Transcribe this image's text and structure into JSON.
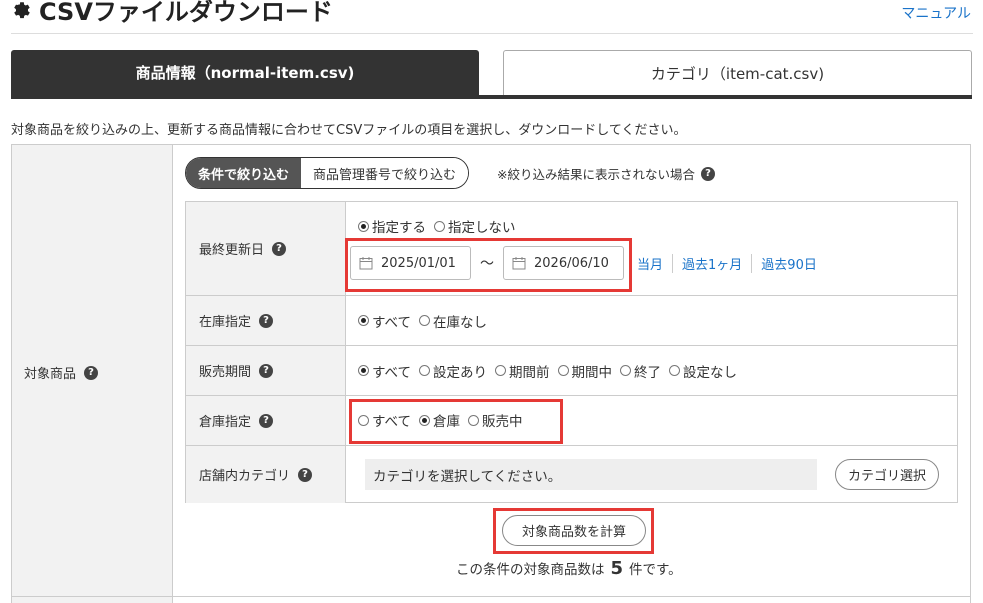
{
  "header": {
    "title": "CSVファイルダウンロード",
    "manual_link": "マニュアル"
  },
  "tabs": [
    {
      "label": "商品情報（normal-item.csv)",
      "active": true
    },
    {
      "label": "カテゴリ（item-cat.csv)",
      "active": false
    }
  ],
  "description": "対象商品を絞り込みの上、更新する商品情報に合わせてCSVファイルの項目を選択し、ダウンロードしてください。",
  "target_label": "対象商品",
  "filter_mode": {
    "options": [
      "条件で絞り込む",
      "商品管理番号で絞り込む"
    ],
    "selected": "条件で絞り込む",
    "note": "※絞り込み結果に表示されない場合"
  },
  "last_updated": {
    "label": "最終更新日",
    "radio": [
      {
        "label": "指定する",
        "checked": true
      },
      {
        "label": "指定しない",
        "checked": false
      }
    ],
    "date_from": "2025/01/01",
    "separator": "～",
    "date_to": "2026/06/10",
    "quick_links": [
      "当月",
      "過去1ヶ月",
      "過去90日"
    ]
  },
  "stock": {
    "label": "在庫指定",
    "radio": [
      {
        "label": "すべて",
        "checked": true
      },
      {
        "label": "在庫なし",
        "checked": false
      }
    ]
  },
  "sales_period": {
    "label": "販売期間",
    "radio": [
      {
        "label": "すべて",
        "checked": true
      },
      {
        "label": "設定あり",
        "checked": false
      },
      {
        "label": "期間前",
        "checked": false
      },
      {
        "label": "期間中",
        "checked": false
      },
      {
        "label": "終了",
        "checked": false
      },
      {
        "label": "設定なし",
        "checked": false
      }
    ]
  },
  "warehouse": {
    "label": "倉庫指定",
    "radio": [
      {
        "label": "すべて",
        "checked": false
      },
      {
        "label": "倉庫",
        "checked": true
      },
      {
        "label": "販売中",
        "checked": false
      }
    ]
  },
  "store_category": {
    "label": "店舗内カテゴリ",
    "placeholder": "カテゴリを選択してください。",
    "button": "カテゴリ選択"
  },
  "calc_button": "対象商品数を計算",
  "result": {
    "prefix": "この条件の対象商品数は",
    "count": "5",
    "suffix": "件です。"
  },
  "colors": {
    "accent_dark": "#333333",
    "link": "#1a73c9",
    "highlight_box": "#e53935"
  }
}
